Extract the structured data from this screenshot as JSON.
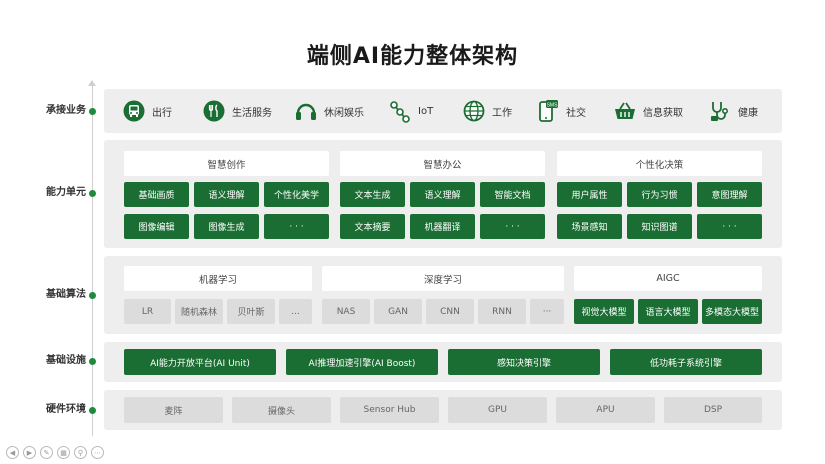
{
  "title": "端侧AI能力整体架构",
  "rows": {
    "scenario": "承接业务",
    "capability": "能力单元",
    "algorithm": "基础算法",
    "infrastructure": "基础设施",
    "hardware": "硬件环境"
  },
  "scenarios": [
    {
      "label": "出行",
      "icon": "bus-icon"
    },
    {
      "label": "生活服务",
      "icon": "utensils-icon"
    },
    {
      "label": "休闲娱乐",
      "icon": "headphones-icon"
    },
    {
      "label": "IoT",
      "icon": "iot-nodes-icon"
    },
    {
      "label": "工作",
      "icon": "globe-icon"
    },
    {
      "label": "社交",
      "icon": "sms-phone-icon"
    },
    {
      "label": "信息获取",
      "icon": "basket-icon"
    },
    {
      "label": "健康",
      "icon": "stethoscope-icon"
    }
  ],
  "capability_groups": [
    {
      "title": "智慧创作",
      "items": [
        "基础画质",
        "语义理解",
        "个性化美学",
        "图像编辑",
        "图像生成",
        "· · ·"
      ]
    },
    {
      "title": "智慧办公",
      "items": [
        "文本生成",
        "语义理解",
        "智能文档",
        "文本摘要",
        "机器翻译",
        "· · ·"
      ]
    },
    {
      "title": "个性化决策",
      "items": [
        "用户属性",
        "行为习惯",
        "意图理解",
        "场景感知",
        "知识图谱",
        "· · ·"
      ]
    }
  ],
  "algorithm_groups": [
    {
      "title": "机器学习",
      "items": [
        "LR",
        "随机森林",
        "贝叶斯",
        "..."
      ]
    },
    {
      "title": "深度学习",
      "items": [
        "NAS",
        "GAN",
        "CNN",
        "RNN",
        "···"
      ]
    },
    {
      "title": "AIGC",
      "items": [
        "视觉大模型",
        "语言大模型",
        "多模态大模型"
      ]
    }
  ],
  "infrastructure": [
    "AI能力开放平台(AI Unit)",
    "AI推理加速引擎(AI Boost)",
    "感知决策引擎",
    "低功耗子系统引擎"
  ],
  "hardware": [
    "麦阵",
    "摄像头",
    "Sensor Hub",
    "GPU",
    "APU",
    "DSP"
  ],
  "colors": {
    "accent": "#1b6e33",
    "dot": "#1e8a3c",
    "panel": "#eeeeee",
    "gray_box": "#dcdcdc"
  }
}
